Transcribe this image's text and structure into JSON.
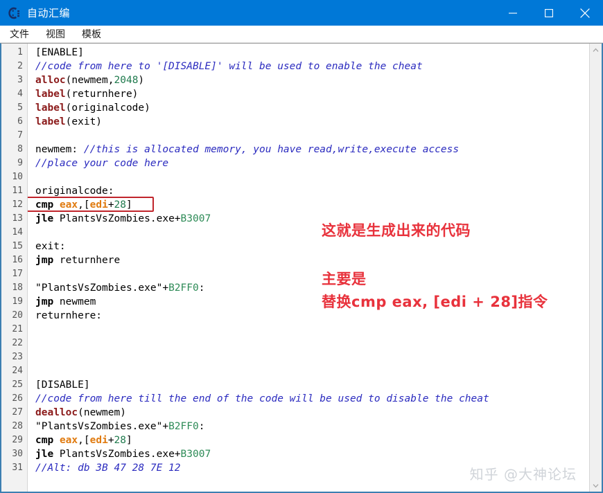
{
  "window": {
    "title": "自动汇编",
    "icon": "cheat-engine-logo-icon",
    "accent_color": "#0078d7",
    "buttons": {
      "minimize": "minimize-icon",
      "maximize": "maximize-icon",
      "close": "close-icon"
    }
  },
  "menubar": {
    "items": [
      {
        "label": "文件"
      },
      {
        "label": "视图"
      },
      {
        "label": "模板"
      }
    ]
  },
  "editor": {
    "line_numbers": [
      1,
      2,
      3,
      4,
      5,
      6,
      7,
      8,
      9,
      10,
      11,
      12,
      13,
      14,
      15,
      16,
      17,
      18,
      19,
      20,
      21,
      22,
      23,
      24,
      25,
      26,
      27,
      28,
      29,
      30,
      31
    ],
    "highlight": {
      "line": 12,
      "color": "#c0242b"
    },
    "lines": [
      {
        "n": 1,
        "tokens": [
          {
            "t": "[ENABLE]",
            "c": "plain"
          }
        ]
      },
      {
        "n": 2,
        "tokens": [
          {
            "t": "//code from here to '[DISABLE]' will be used to enable the cheat",
            "c": "cmt"
          }
        ]
      },
      {
        "n": 3,
        "tokens": [
          {
            "t": "alloc",
            "c": "kw"
          },
          {
            "t": "(newmem,",
            "c": "plain"
          },
          {
            "t": "2048",
            "c": "num"
          },
          {
            "t": ")",
            "c": "plain"
          }
        ]
      },
      {
        "n": 4,
        "tokens": [
          {
            "t": "label",
            "c": "kw"
          },
          {
            "t": "(returnhere)",
            "c": "plain"
          }
        ]
      },
      {
        "n": 5,
        "tokens": [
          {
            "t": "label",
            "c": "kw"
          },
          {
            "t": "(originalcode)",
            "c": "plain"
          }
        ]
      },
      {
        "n": 6,
        "tokens": [
          {
            "t": "label",
            "c": "kw"
          },
          {
            "t": "(exit)",
            "c": "plain"
          }
        ]
      },
      {
        "n": 7,
        "tokens": []
      },
      {
        "n": 8,
        "tokens": [
          {
            "t": "newmem: ",
            "c": "plain"
          },
          {
            "t": "//this is allocated memory, you have read,write,execute access",
            "c": "cmt"
          }
        ]
      },
      {
        "n": 9,
        "tokens": [
          {
            "t": "//place your code here",
            "c": "cmt"
          }
        ]
      },
      {
        "n": 10,
        "tokens": []
      },
      {
        "n": 11,
        "tokens": [
          {
            "t": "originalcode:",
            "c": "plain"
          }
        ]
      },
      {
        "n": 12,
        "tokens": [
          {
            "t": "cmp",
            "c": "mn"
          },
          {
            "t": " ",
            "c": "plain"
          },
          {
            "t": "eax",
            "c": "reg"
          },
          {
            "t": ",[",
            "c": "plain"
          },
          {
            "t": "edi",
            "c": "reg"
          },
          {
            "t": "+",
            "c": "plain"
          },
          {
            "t": "28",
            "c": "num"
          },
          {
            "t": "]",
            "c": "plain"
          }
        ]
      },
      {
        "n": 13,
        "tokens": [
          {
            "t": "jle",
            "c": "mn"
          },
          {
            "t": " PlantsVsZombies.exe+",
            "c": "plain"
          },
          {
            "t": "B3007",
            "c": "hex"
          }
        ]
      },
      {
        "n": 14,
        "tokens": []
      },
      {
        "n": 15,
        "tokens": [
          {
            "t": "exit:",
            "c": "plain"
          }
        ]
      },
      {
        "n": 16,
        "tokens": [
          {
            "t": "jmp",
            "c": "mn"
          },
          {
            "t": " returnhere",
            "c": "plain"
          }
        ]
      },
      {
        "n": 17,
        "tokens": []
      },
      {
        "n": 18,
        "tokens": [
          {
            "t": "\"PlantsVsZombies.exe\"+",
            "c": "plain"
          },
          {
            "t": "B2FF0",
            "c": "hex"
          },
          {
            "t": ":",
            "c": "plain"
          }
        ]
      },
      {
        "n": 19,
        "tokens": [
          {
            "t": "jmp",
            "c": "mn"
          },
          {
            "t": " newmem",
            "c": "plain"
          }
        ]
      },
      {
        "n": 20,
        "tokens": [
          {
            "t": "returnhere:",
            "c": "plain"
          }
        ]
      },
      {
        "n": 21,
        "tokens": []
      },
      {
        "n": 22,
        "tokens": []
      },
      {
        "n": 23,
        "tokens": []
      },
      {
        "n": 24,
        "tokens": []
      },
      {
        "n": 25,
        "tokens": [
          {
            "t": "[DISABLE]",
            "c": "plain"
          }
        ]
      },
      {
        "n": 26,
        "tokens": [
          {
            "t": "//code from here till the end of the code will be used to disable the cheat",
            "c": "cmt"
          }
        ]
      },
      {
        "n": 27,
        "tokens": [
          {
            "t": "dealloc",
            "c": "kw"
          },
          {
            "t": "(newmem)",
            "c": "plain"
          }
        ]
      },
      {
        "n": 28,
        "tokens": [
          {
            "t": "\"PlantsVsZombies.exe\"+",
            "c": "plain"
          },
          {
            "t": "B2FF0",
            "c": "hex"
          },
          {
            "t": ":",
            "c": "plain"
          }
        ]
      },
      {
        "n": 29,
        "tokens": [
          {
            "t": "cmp",
            "c": "mn"
          },
          {
            "t": " ",
            "c": "plain"
          },
          {
            "t": "eax",
            "c": "reg"
          },
          {
            "t": ",[",
            "c": "plain"
          },
          {
            "t": "edi",
            "c": "reg"
          },
          {
            "t": "+",
            "c": "plain"
          },
          {
            "t": "28",
            "c": "num"
          },
          {
            "t": "]",
            "c": "plain"
          }
        ]
      },
      {
        "n": 30,
        "tokens": [
          {
            "t": "jle",
            "c": "mn"
          },
          {
            "t": " PlantsVsZombies.exe+",
            "c": "plain"
          },
          {
            "t": "B3007",
            "c": "hex"
          }
        ]
      },
      {
        "n": 31,
        "tokens": [
          {
            "t": "//Alt: db 3B 47 28 7E 12",
            "c": "cmt"
          }
        ]
      }
    ]
  },
  "annotations": {
    "color": "#e8323c",
    "items": [
      {
        "id": "anno-1",
        "text": "这就是生成出来的代码"
      },
      {
        "id": "anno-2",
        "text": "主要是"
      },
      {
        "id": "anno-3",
        "text": "替换cmp eax, [edi + 28]指令"
      }
    ]
  },
  "scrollbar": {
    "up_arrow": "chevron-up-icon",
    "down_arrow": "chevron-down-icon"
  },
  "watermark": {
    "text": "知乎 @大神论坛"
  }
}
